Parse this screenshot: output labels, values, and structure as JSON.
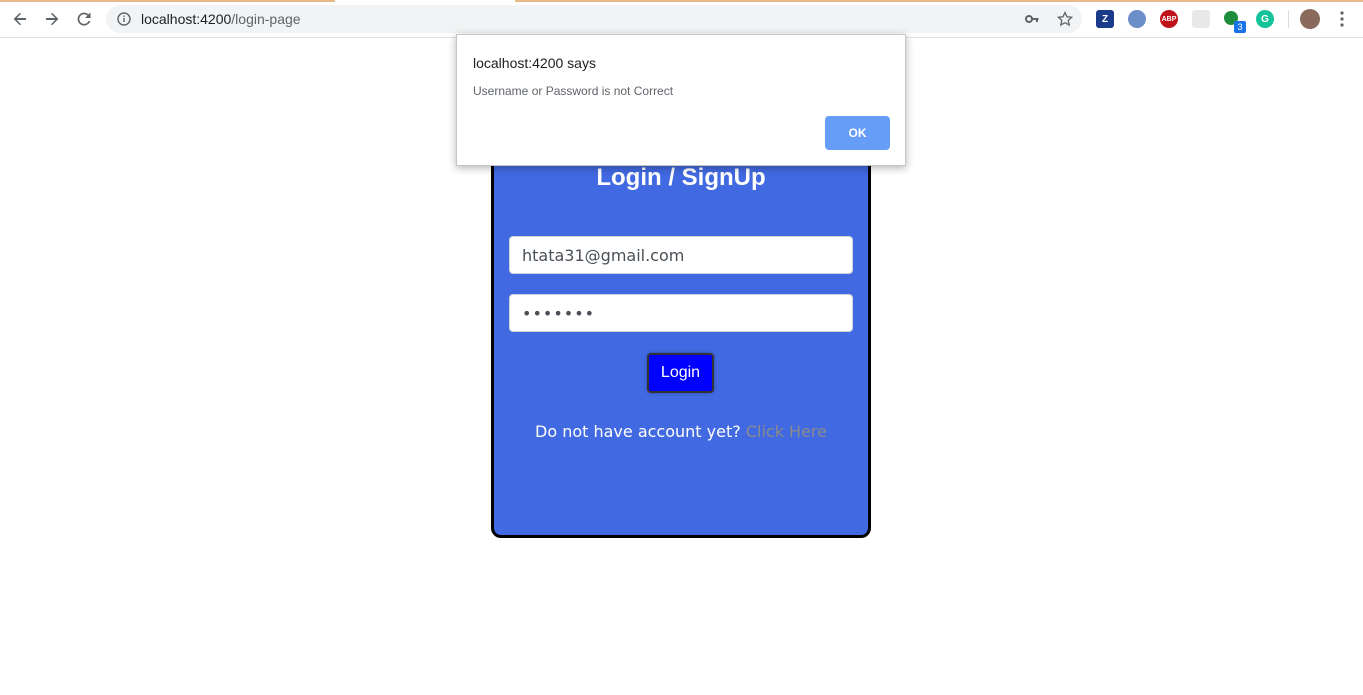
{
  "browser": {
    "url_host": "localhost:4200",
    "url_path": "/login-page",
    "extensions": [
      {
        "name": "zotero",
        "label": "Z",
        "color": "#1a3a8a"
      },
      {
        "name": "quill",
        "label": "",
        "color": "#6c8ec9"
      },
      {
        "name": "adblock",
        "label": "ABP",
        "color": "#c0141a"
      },
      {
        "name": "blank-ext",
        "label": "",
        "color": "#e8e8e8"
      },
      {
        "name": "green-ext",
        "label": "",
        "color": "#1e8e3e",
        "badge": "3"
      },
      {
        "name": "grammarly",
        "label": "G",
        "color": "#15c39a"
      }
    ]
  },
  "dialog": {
    "title": "localhost:4200 says",
    "message": "Username or Password is not Correct",
    "ok_label": "OK"
  },
  "form": {
    "title": "Login / SignUp",
    "email_value": "htata31@gmail.com",
    "password_value": "•••••••",
    "login_label": "Login",
    "signup_prompt": "Do not have account yet?",
    "signup_link": "Click Here"
  }
}
